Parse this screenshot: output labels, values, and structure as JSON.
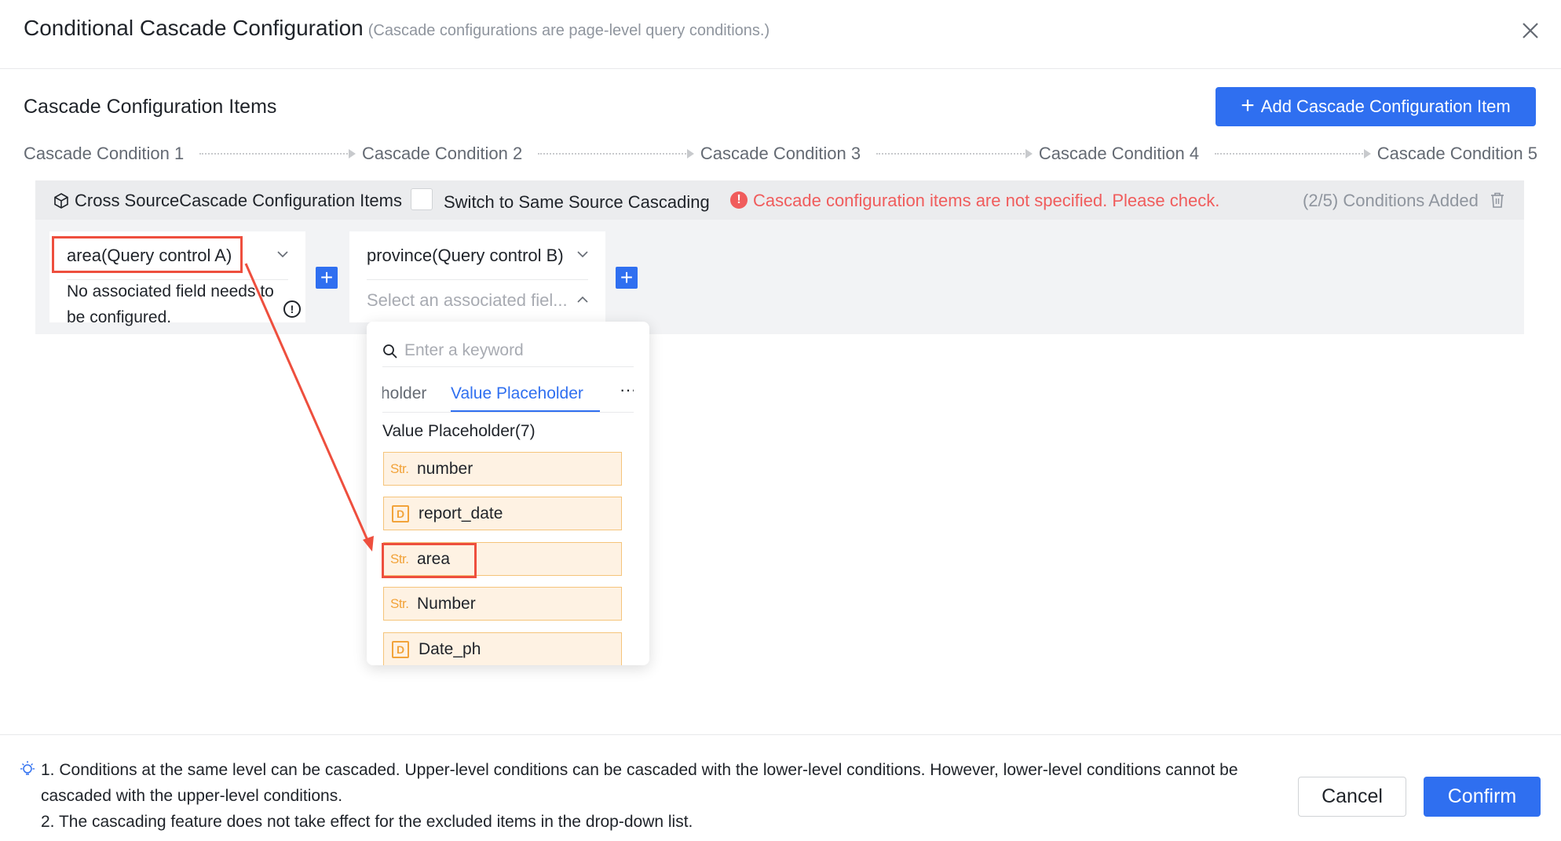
{
  "dialog": {
    "title": "Conditional Cascade Configuration",
    "subtitle": "(Cascade configurations are page-level query conditions.)"
  },
  "section": {
    "title": "Cascade Configuration Items",
    "add_button_label": "Add Cascade Configuration Item"
  },
  "steps": [
    "Cascade Condition 1",
    "Cascade Condition 2",
    "Cascade Condition 3",
    "Cascade Condition 4",
    "Cascade Condition 5"
  ],
  "config": {
    "label": "Cross SourceCascade Configuration Items",
    "switch_label": "Switch to Same Source Cascading",
    "switch_checked": false,
    "error_text": "Cascade configuration items are not specified. Please check.",
    "count_text": "(2/5) Conditions Added"
  },
  "cards": [
    {
      "control": "area(Query control A)",
      "note": "No associated field needs to be configured."
    },
    {
      "control": "province(Query control B)",
      "field_placeholder": "Select an associated fiel..."
    }
  ],
  "dropdown": {
    "search_placeholder": "Enter a keyword",
    "tabs": [
      "holder",
      "Value Placeholder"
    ],
    "active_tab": "Value Placeholder",
    "more": "···",
    "group_label": "Value Placeholder(7)",
    "fields": [
      {
        "type": "Str.",
        "name": "number"
      },
      {
        "type": "D",
        "name": "report_date"
      },
      {
        "type": "Str.",
        "name": "area",
        "highlighted": true
      },
      {
        "type": "Str.",
        "name": "Number"
      },
      {
        "type": "D",
        "name": "Date_ph"
      }
    ]
  },
  "footer": {
    "tips": [
      "1. Conditions at the same level can be cascaded. Upper-level conditions can be cascaded with the lower-level conditions. However, lower-level conditions cannot be cascaded with the upper-level conditions.",
      "2. The cascading feature does not take effect for the excluded items in the drop-down list."
    ],
    "cancel_label": "Cancel",
    "confirm_label": "Confirm"
  },
  "colors": {
    "primary": "#2f6ff0",
    "error": "#f05c5c",
    "annotation": "#ee4f3e",
    "field_bg": "#fef2e3",
    "field_type": "#f2a33a"
  }
}
